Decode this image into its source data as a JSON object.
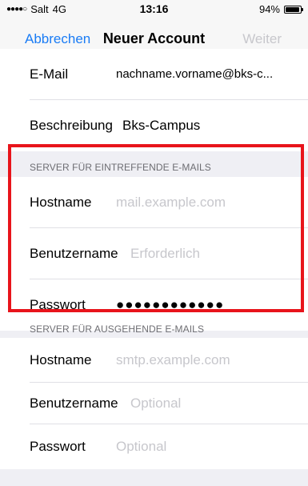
{
  "status_bar": {
    "signal": "●●●●○",
    "carrier": "Salt",
    "network": "4G",
    "time": "13:16",
    "battery_percent": "94%",
    "battery_level": 0.94
  },
  "nav": {
    "cancel": "Abbrechen",
    "title": "Neuer Account",
    "next": "Weiter"
  },
  "account": {
    "email_label": "E-Mail",
    "email_value": "nachname.vorname@bks-c...",
    "description_label": "Beschreibung",
    "description_value": "Bks-Campus"
  },
  "incoming": {
    "header": "SERVER FÜR EINTREFFENDE E-MAILS",
    "hostname_label": "Hostname",
    "hostname_placeholder": "mail.example.com",
    "username_label": "Benutzername",
    "username_placeholder": "Erforderlich",
    "password_label": "Passwort",
    "password_value": "●●●●●●●●●●●●"
  },
  "outgoing": {
    "header": "SERVER FÜR AUSGEHENDE E-MAILS",
    "hostname_label": "Hostname",
    "hostname_placeholder": "smtp.example.com",
    "username_label": "Benutzername",
    "username_placeholder": "Optional",
    "password_label": "Passwort",
    "password_placeholder": "Optional"
  },
  "colors": {
    "accent": "#1a7cf5",
    "highlight": "#e8141b",
    "placeholder": "#c7c7cc"
  }
}
